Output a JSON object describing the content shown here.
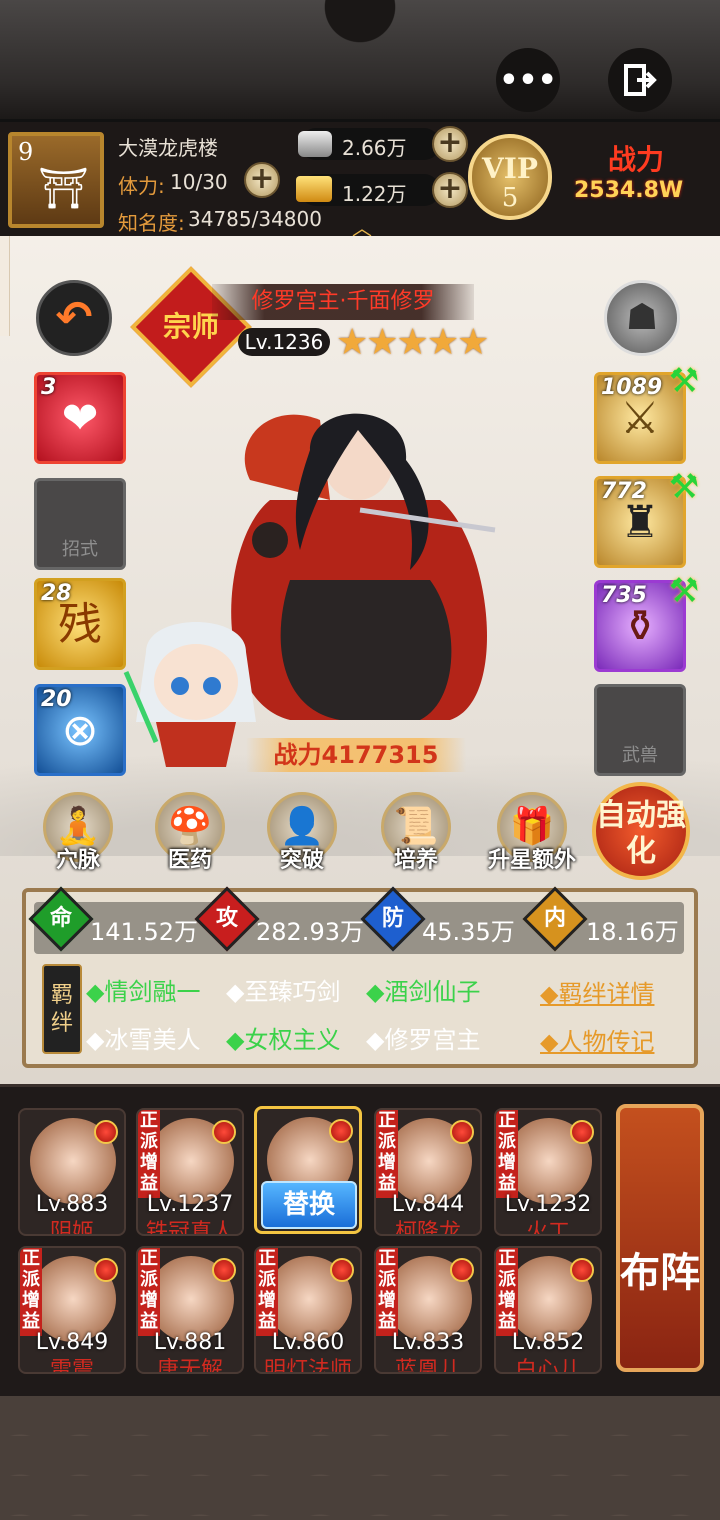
{
  "header": {
    "more_icon": "more-icon",
    "exit_icon": "exit-icon"
  },
  "player": {
    "level": "9",
    "guild_name": "大漠龙虎楼",
    "stamina_label": "体力:",
    "stamina_value": "10/30",
    "fame_label": "知名度:",
    "fame_value": "34785/34800",
    "silver": "2.66万",
    "gold": "1.22万",
    "vip_label": "VIP",
    "vip_level": "5",
    "power_label": "战力",
    "power_value": "2534.8W"
  },
  "hero": {
    "rank": "宗师",
    "title": "修罗宫主·千面修罗",
    "level": "Lv.1236",
    "stars": "★★★★★",
    "power_label": "战力4177315",
    "skill_count": "3",
    "skill_empty_label": "招式",
    "item_28": "28",
    "item_28_text": "残",
    "item_20": "20",
    "weapon_level": "1089",
    "armor_level": "772",
    "accessory_level": "735",
    "beast_label": "武兽"
  },
  "features": [
    {
      "label": "穴脉",
      "icon": "meridian-icon"
    },
    {
      "label": "医药",
      "icon": "medicine-icon"
    },
    {
      "label": "突破",
      "icon": "breakthrough-icon"
    },
    {
      "label": "培养",
      "icon": "train-icon"
    },
    {
      "label": "升星额外",
      "icon": "star-up-icon"
    }
  ],
  "auto_enhance": "自动强化",
  "stats": [
    {
      "key": "命",
      "value": "141.52万",
      "color": "#1f9d2a"
    },
    {
      "key": "攻",
      "value": "282.93万",
      "color": "#c81e1e"
    },
    {
      "key": "防",
      "value": "45.35万",
      "color": "#1e5fcf"
    },
    {
      "key": "内",
      "value": "18.16万",
      "color": "#d6921e"
    }
  ],
  "bonds": {
    "tag": "羁绊",
    "items": [
      {
        "label": "◆情剑融一",
        "active": true
      },
      {
        "label": "◆至臻巧剑",
        "active": false
      },
      {
        "label": "◆酒剑仙子",
        "active": true
      },
      {
        "label": "◆冰雪美人",
        "active": false
      },
      {
        "label": "◆女权主义",
        "active": true
      },
      {
        "label": "◆修罗宫主",
        "active": false
      }
    ],
    "details_link": "◆羁绊详情",
    "bio_link": "◆人物传记"
  },
  "roster": {
    "ribbon_text": "正派增益",
    "swap_label": "替换",
    "formation_label": "布阵",
    "heroes": [
      {
        "level": "Lv.883",
        "name": "阴姬"
      },
      {
        "level": "Lv.1237",
        "name": "铁冠真人"
      },
      {
        "level": "",
        "name": ""
      },
      {
        "level": "Lv.844",
        "name": "柯降龙"
      },
      {
        "level": "Lv.1232",
        "name": "火工"
      },
      {
        "level": "Lv.849",
        "name": "雷震"
      },
      {
        "level": "Lv.881",
        "name": "唐无解"
      },
      {
        "level": "Lv.860",
        "name": "明灯法师"
      },
      {
        "level": "Lv.833",
        "name": "蓝凰儿"
      },
      {
        "level": "Lv.852",
        "name": "白心儿"
      }
    ]
  }
}
